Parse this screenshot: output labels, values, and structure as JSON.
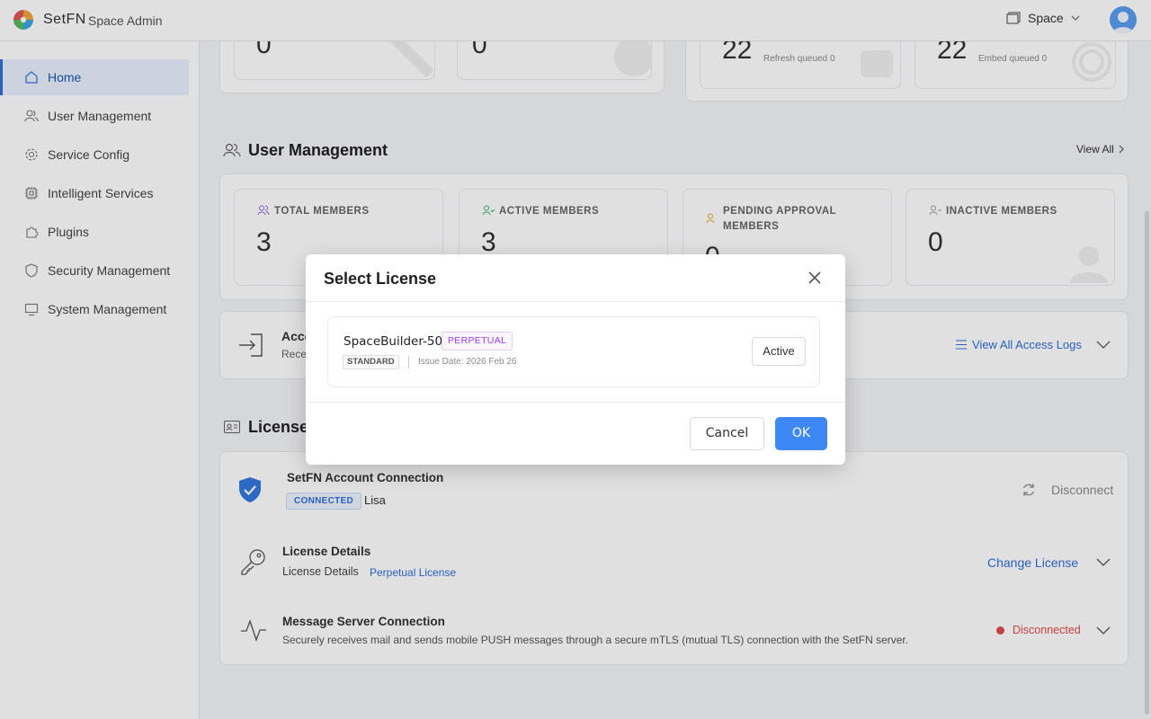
{
  "header": {
    "brand": "SetFN",
    "subtitle": "Space Admin",
    "space_label": "Space"
  },
  "sidebar": {
    "items": [
      {
        "label": "Home",
        "icon": "home-icon",
        "active": true
      },
      {
        "label": "User Management",
        "icon": "users-icon"
      },
      {
        "label": "Service Config",
        "icon": "gear-icon"
      },
      {
        "label": "Intelligent Services",
        "icon": "chip-icon"
      },
      {
        "label": "Plugins",
        "icon": "puzzle-icon"
      },
      {
        "label": "Security Management",
        "icon": "shield-icon"
      },
      {
        "label": "System Management",
        "icon": "monitor-icon"
      }
    ]
  },
  "top_stats": {
    "left_values": [
      "0",
      "0"
    ],
    "right": [
      {
        "value": "22",
        "note": "Refresh queued 0"
      },
      {
        "value": "22",
        "note": "Embed queued 0"
      }
    ]
  },
  "user_management": {
    "title": "User Management",
    "view_all": "View All",
    "stats": [
      {
        "label": "TOTAL MEMBERS",
        "value": "3",
        "icon_color": "#8b6fd6"
      },
      {
        "label": "ACTIVE MEMBERS",
        "value": "3",
        "icon_color": "#3bb07a"
      },
      {
        "label": "PENDING APPROVAL MEMBERS",
        "value": "0",
        "icon_color": "#e0a52c"
      },
      {
        "label": "INACTIVE MEMBERS",
        "value": "0",
        "icon_color": "#999999"
      }
    ]
  },
  "access_logs": {
    "title_partial": "Acce",
    "sub_partial": "Rece",
    "view_all": "View All Access Logs"
  },
  "license": {
    "title_partial": "License",
    "account": {
      "title": "SetFN Account Connection",
      "badge": "CONNECTED",
      "user": "Lisa",
      "action": "Disconnect"
    },
    "details": {
      "title": "License Details",
      "label": "License Details",
      "type": "Perpetual License",
      "action": "Change License"
    },
    "message_server": {
      "title": "Message Server Connection",
      "desc": "Securely receives mail and sends mobile PUSH messages through a secure mTLS (mutual TLS) connection with the SetFN server.",
      "status": "Disconnected",
      "status_color": "#e04a4a"
    }
  },
  "modal": {
    "title": "Select License",
    "license_name": "SpaceBuilder-50",
    "tag": "PERPETUAL",
    "edition": "STANDARD",
    "issue_date": "Issue Date: 2026 Feb 26",
    "active_label": "Active",
    "cancel": "Cancel",
    "ok": "OK"
  },
  "colors": {
    "accent": "#2f6fd8",
    "ok_button": "#3d88f5"
  }
}
